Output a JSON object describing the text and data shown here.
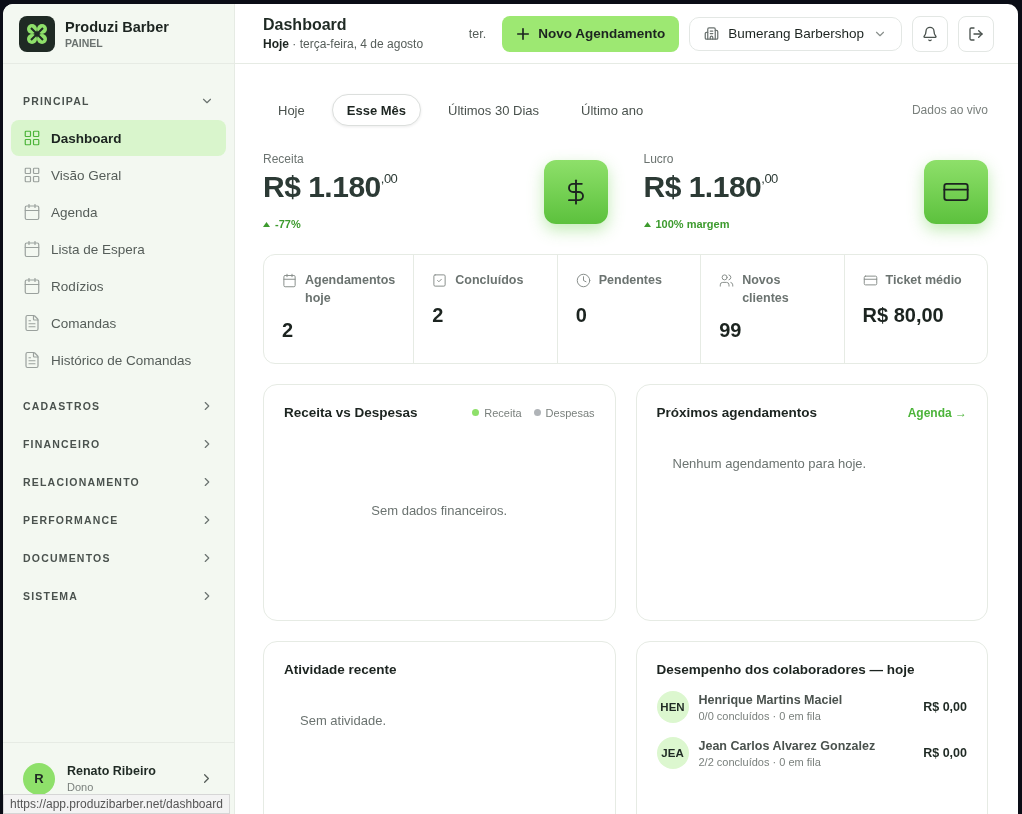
{
  "brand": {
    "name": "Produzi Barber",
    "subtitle": "PAINEL"
  },
  "sidebar": {
    "sections": [
      {
        "label": "PRINCIPAL",
        "expanded": true,
        "items": [
          {
            "label": "Dashboard",
            "kind": "grid",
            "selected": true
          },
          {
            "label": "Visão Geral",
            "kind": "grid",
            "selected": false
          },
          {
            "label": "Agenda",
            "kind": "calendar",
            "selected": false
          },
          {
            "label": "Lista de Espera",
            "kind": "calendar",
            "selected": false
          },
          {
            "label": "Rodízios",
            "kind": "calendar",
            "selected": false
          },
          {
            "label": "Comandas",
            "kind": "doc",
            "selected": false
          },
          {
            "label": "Histórico de Comandas",
            "kind": "doc",
            "selected": false
          }
        ]
      },
      {
        "label": "CADASTROS",
        "expanded": false
      },
      {
        "label": "FINANCEIRO",
        "expanded": false
      },
      {
        "label": "RELACIONAMENTO",
        "expanded": false
      },
      {
        "label": "PERFORMANCE",
        "expanded": false
      },
      {
        "label": "DOCUMENTOS",
        "expanded": false
      },
      {
        "label": "SISTEMA",
        "expanded": false
      }
    ]
  },
  "user": {
    "initial": "R",
    "name": "Renato Ribeiro",
    "role": "Dono"
  },
  "header": {
    "title": "Dashboard",
    "date_lead": "Hoje",
    "date": " · terça-feira, 4 de agosto",
    "short_date": "ter.",
    "new_button": "Novo Agendamento",
    "shop": "Bumerang Barbershop"
  },
  "period_tabs": [
    {
      "label": "Hoje",
      "selected": false
    },
    {
      "label": "Esse Mês",
      "selected": true
    },
    {
      "label": "Últimos 30 Dias",
      "selected": false
    },
    {
      "label": "Último ano",
      "selected": false
    }
  ],
  "live_label": "Dados ao vivo",
  "kpis": [
    {
      "label": "Receita",
      "value": "R$ 1.180",
      "cents": ",00",
      "note": "-77%",
      "kind": "dollar"
    },
    {
      "label": "Lucro",
      "value": "R$ 1.180",
      "cents": ",00",
      "note": "100% margem",
      "kind": "card"
    }
  ],
  "stats": [
    {
      "label": "Agendamentos hoje",
      "value": "2",
      "kind": "calendar"
    },
    {
      "label": "Concluídos",
      "value": "2",
      "kind": "check"
    },
    {
      "label": "Pendentes",
      "value": "0",
      "kind": "clock"
    },
    {
      "label": "Novos clientes",
      "value": "99",
      "kind": "users"
    },
    {
      "label": "Ticket médio",
      "value": "R$ 80,00",
      "kind": "card"
    }
  ],
  "revenue_panel": {
    "title": "Receita vs Despesas",
    "legend": [
      {
        "label": "Receita",
        "color": "#8ee06a"
      },
      {
        "label": "Despesas",
        "color": "#b0b4b8"
      }
    ],
    "empty": "Sem dados financeiros."
  },
  "appointments_panel": {
    "title": "Próximos agendamentos",
    "link": "Agenda →",
    "empty": "Nenhum agendamento para hoje."
  },
  "activity_panel": {
    "title": "Atividade recente",
    "empty": "Sem atividade."
  },
  "staff_panel": {
    "title": "Desempenho dos colaboradores — hoje",
    "rows": [
      {
        "initials": "HEN",
        "name": "Henrique Martins Maciel",
        "detail": "0/0 concluídos · 0 em fila",
        "amount": "R$ 0,00"
      },
      {
        "initials": "JEA",
        "name": "Jean Carlos Alvarez Gonzalez",
        "detail": "2/2 concluídos · 0 em fila",
        "amount": "R$ 0,00"
      }
    ]
  },
  "status_bar": {
    "url": "https://app.produzibarber.net/dashboard"
  }
}
